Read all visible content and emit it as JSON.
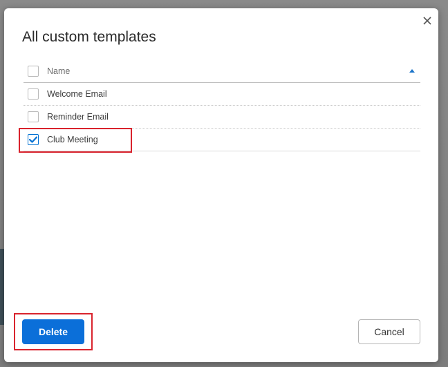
{
  "dialog": {
    "title": "All custom templates",
    "close_icon": "close-icon"
  },
  "table": {
    "header": {
      "column_name": "Name",
      "sort_icon": "sort-ascending-icon",
      "checked": false
    },
    "rows": [
      {
        "name": "Welcome Email",
        "checked": false
      },
      {
        "name": "Reminder Email",
        "checked": false
      },
      {
        "name": "Club Meeting",
        "checked": true
      }
    ]
  },
  "footer": {
    "delete_label": "Delete",
    "cancel_label": "Cancel"
  },
  "colors": {
    "primary": "#0b6fd9",
    "highlight": "#d9232d",
    "checkbox_check": "#0070d2"
  }
}
